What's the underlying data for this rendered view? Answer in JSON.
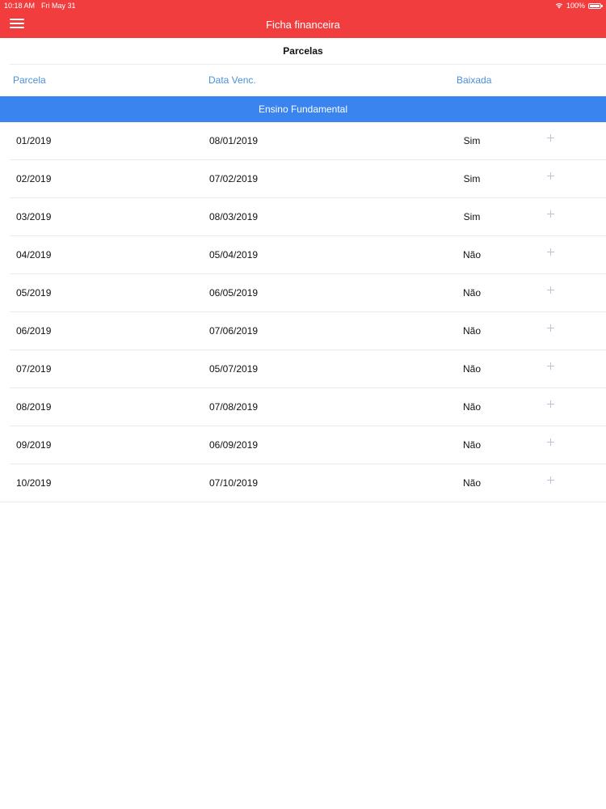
{
  "status_bar": {
    "time": "10:18 AM",
    "date": "Fri May 31",
    "battery": "100%"
  },
  "nav": {
    "title": "Ficha financeira",
    "menu_icon": "hamburger-menu-icon"
  },
  "section": {
    "title": "Parcelas"
  },
  "columns": {
    "parcela": "Parcela",
    "data_venc": "Data Venc.",
    "baixada": "Baixada"
  },
  "group": {
    "title": "Ensino Fundamental"
  },
  "rows": [
    {
      "parcela": "01/2019",
      "data_venc": "08/01/2019",
      "baixada": "Sim"
    },
    {
      "parcela": "02/2019",
      "data_venc": "07/02/2019",
      "baixada": "Sim"
    },
    {
      "parcela": "03/2019",
      "data_venc": "08/03/2019",
      "baixada": "Sim"
    },
    {
      "parcela": "04/2019",
      "data_venc": "05/04/2019",
      "baixada": "Não"
    },
    {
      "parcela": "05/2019",
      "data_venc": "06/05/2019",
      "baixada": "Não"
    },
    {
      "parcela": "06/2019",
      "data_venc": "07/06/2019",
      "baixada": "Não"
    },
    {
      "parcela": "07/2019",
      "data_venc": "05/07/2019",
      "baixada": "Não"
    },
    {
      "parcela": "08/2019",
      "data_venc": "07/08/2019",
      "baixada": "Não"
    },
    {
      "parcela": "09/2019",
      "data_venc": "06/09/2019",
      "baixada": "Não"
    },
    {
      "parcela": "10/2019",
      "data_venc": "07/10/2019",
      "baixada": "Não"
    }
  ],
  "colors": {
    "header_red": "#f23d3f",
    "group_blue": "#3a84f0",
    "column_header_blue": "#4a90d9"
  }
}
